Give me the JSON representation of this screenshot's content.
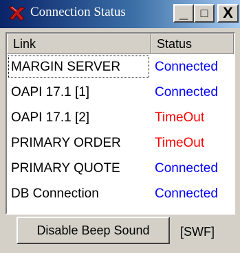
{
  "window": {
    "title": "Connection Status",
    "minimize_label": "_",
    "maximize_label": "□",
    "close_label": "X"
  },
  "table": {
    "columns": [
      "Link",
      "Status"
    ],
    "rows": [
      {
        "link": "MARGIN SERVER",
        "status": "Connected",
        "status_color": "#0000ff",
        "selected": true
      },
      {
        "link": "OAPI 17.1 [1]",
        "status": "Connected",
        "status_color": "#0000ff"
      },
      {
        "link": "OAPI 17.1 [2]",
        "status": "TimeOut",
        "status_color": "#ff0000"
      },
      {
        "link": "PRIMARY ORDER",
        "status": "TimeOut",
        "status_color": "#ff0000"
      },
      {
        "link": "PRIMARY QUOTE",
        "status": "Connected",
        "status_color": "#0000ff"
      },
      {
        "link": "DB Connection",
        "status": "Connected",
        "status_color": "#0000ff"
      }
    ]
  },
  "footer": {
    "beep_button_label": "Disable Beep Sound",
    "mode_label": "[SWF]"
  },
  "icons": {
    "app_icon": "red-x-app-icon"
  },
  "colors": {
    "connected": "#0000ff",
    "timeout": "#ff0000",
    "titlebar_start": "#0a246a",
    "titlebar_end": "#a6caf0"
  }
}
